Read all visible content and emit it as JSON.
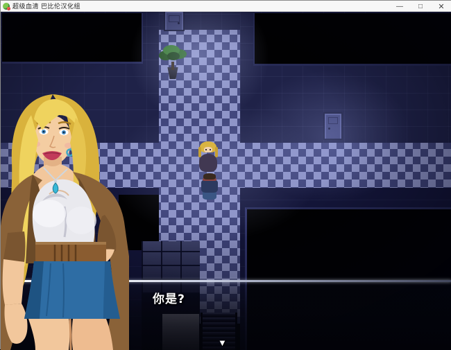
{
  "window": {
    "title": "超级血清 巴比伦汉化组",
    "controls": {
      "minimize": "—",
      "maximize": "□",
      "close": "✕"
    }
  },
  "dialogue": {
    "text": "你是?",
    "continue_indicator": "▼"
  },
  "scene": {
    "colors": {
      "floor_light": "#8d93c6",
      "floor_dark": "#3e4379",
      "wall": "#1f2248",
      "room_void": "#010102",
      "door": "#3f4478",
      "dialogue_line": "#ffffff",
      "hair_blonde": "#e9c94e",
      "jacket_brown": "#8a6238",
      "skirt_blue": "#2e6da4"
    }
  }
}
